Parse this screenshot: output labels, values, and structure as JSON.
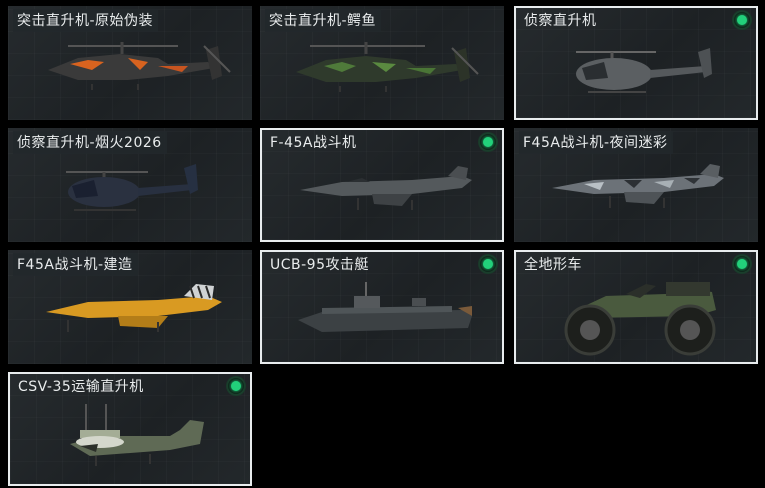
{
  "vehicles": [
    {
      "name": "突击直升机-原始伪装",
      "selected": false,
      "checked": false,
      "icon": "attack-helicopter-orange-camo"
    },
    {
      "name": "突击直升机-鳄鱼",
      "selected": false,
      "checked": false,
      "icon": "attack-helicopter-green-camo"
    },
    {
      "name": "侦察直升机",
      "selected": true,
      "checked": true,
      "icon": "scout-helicopter-grey"
    },
    {
      "name": "侦察直升机-烟火2026",
      "selected": false,
      "checked": false,
      "icon": "scout-helicopter-dark"
    },
    {
      "name": "F-45A战斗机",
      "selected": true,
      "checked": true,
      "icon": "fighter-jet-grey"
    },
    {
      "name": "F45A战斗机-夜间迷彩",
      "selected": false,
      "checked": false,
      "icon": "fighter-jet-night-camo"
    },
    {
      "name": "F45A战斗机-建造",
      "selected": false,
      "checked": false,
      "icon": "fighter-jet-yellow"
    },
    {
      "name": "UCB-95攻击艇",
      "selected": true,
      "checked": true,
      "icon": "attack-boat"
    },
    {
      "name": "全地形车",
      "selected": true,
      "checked": true,
      "icon": "atv"
    },
    {
      "name": "CSV-35运输直升机",
      "selected": true,
      "checked": true,
      "icon": "tiltrotor-transport"
    }
  ],
  "colors": {
    "check": "#22d07a",
    "selected_border": "#e8ecee",
    "card_bg": "#22272a",
    "page_bg": "#000000"
  }
}
